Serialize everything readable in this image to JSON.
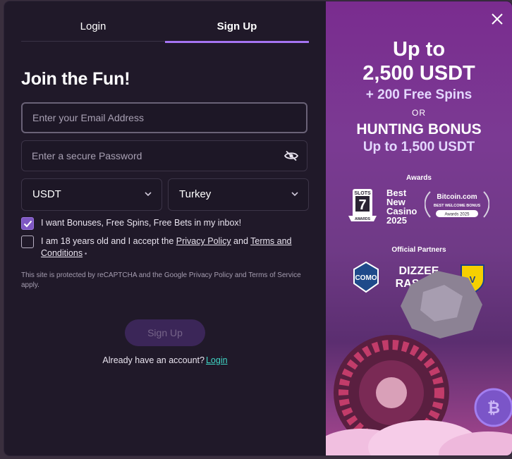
{
  "tabs": {
    "login": "Login",
    "signup": "Sign Up"
  },
  "heading": "Join the Fun!",
  "email": {
    "placeholder": "Enter your Email Address",
    "value": ""
  },
  "password": {
    "placeholder": "Enter a secure Password",
    "value": ""
  },
  "currency": {
    "selected": "USDT"
  },
  "country": {
    "selected": "Turkey"
  },
  "checkbox_bonuses": {
    "label": "I want Bonuses, Free Spins, Free Bets in my inbox!",
    "checked": true
  },
  "checkbox_terms": {
    "text_before": "I am 18 years old and I accept the ",
    "privacy_link": "Privacy Policy",
    "text_mid": " and ",
    "terms_link": "Terms and Conditions",
    "required_mark": " •",
    "checked": false
  },
  "recaptcha_text": "This site is protected by reCAPTCHA and the Google Privacy Policy and Terms of Service apply.",
  "signup_button": "Sign Up",
  "already_text": "Already have an account?",
  "login_link": "Login",
  "promo": {
    "line1": "Up to",
    "line2": "2,500 USDT",
    "line3": "+ 200 Free Spins",
    "line4": "OR",
    "line5": "HUNTING BONUS",
    "line6": "Up to 1,500 USDT",
    "awards_label": "Awards",
    "slots_badge": "SLOTS",
    "slots_number": "7",
    "slots_ribbon": "AWARDS",
    "best_line1": "Best",
    "best_line2": "New",
    "best_line3": "Casino",
    "best_year": "2025",
    "bitcoin_name": "Bitcoin.com",
    "bitcoin_sub": "BEST WELCOME BONUS",
    "bitcoin_year": "Awards 2025",
    "partners_label": "Official Partners",
    "partner_como": "COMO",
    "partner_dizzee1": "DIZZEE",
    "partner_dizzee2": "RASCAL"
  },
  "colors": {
    "accent": "#a574f2",
    "link": "#3fd6c5",
    "modal_bg": "#201929",
    "button_bg": "#3b2658"
  }
}
